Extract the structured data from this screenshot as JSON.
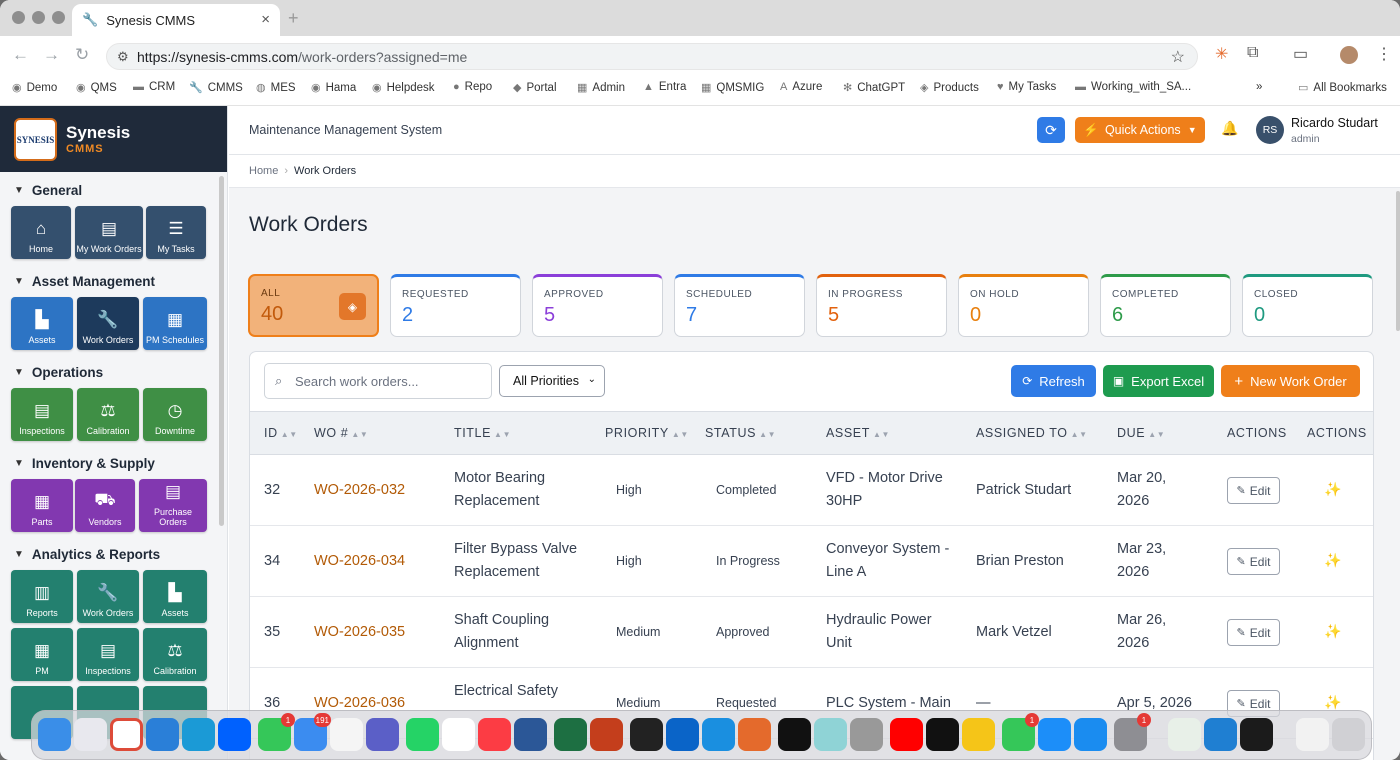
{
  "browser": {
    "tab_title": "Synesis CMMS",
    "url_host": "https://synesis-cmms.com",
    "url_path": "/work-orders?assigned=me",
    "bookmarks": [
      "Demo",
      "QMS",
      "CRM",
      "CMMS",
      "MES",
      "Hama",
      "Helpdesk",
      "Repo",
      "Portal",
      "Admin",
      "Entra",
      "QMSMIG",
      "Azure",
      "ChatGPT",
      "Products",
      "My Tasks",
      "Working_with_SA...",
      "All Bookmarks"
    ]
  },
  "brand": {
    "name": "Synesis",
    "sub": "CMMS",
    "logo_text": "SYNESIS"
  },
  "sidebar": {
    "sections": [
      {
        "title": "General",
        "items": [
          "Home",
          "My Work Orders",
          "My Tasks"
        ]
      },
      {
        "title": "Asset Management",
        "items": [
          "Assets",
          "Work Orders",
          "PM Schedules"
        ]
      },
      {
        "title": "Operations",
        "items": [
          "Inspections",
          "Calibration",
          "Downtime"
        ]
      },
      {
        "title": "Inventory & Supply",
        "items": [
          "Parts",
          "Vendors",
          "Purchase Orders"
        ]
      },
      {
        "title": "Analytics & Reports",
        "items": [
          "Reports",
          "Work Orders",
          "Assets",
          "PM",
          "Inspections",
          "Calibration"
        ]
      }
    ]
  },
  "header": {
    "system_title": "Maintenance Management System",
    "quick_actions": "Quick Actions",
    "user_initials": "RS",
    "user_name": "Ricardo Studart",
    "user_role": "admin"
  },
  "breadcrumb": {
    "home": "Home",
    "current": "Work Orders"
  },
  "page_title": "Work Orders",
  "status_cards": [
    {
      "label": "ALL",
      "value": "40",
      "color": "#ef7f1a"
    },
    {
      "label": "REQUESTED",
      "value": "2",
      "color": "#2f7be6"
    },
    {
      "label": "APPROVED",
      "value": "5",
      "color": "#8b3fd9"
    },
    {
      "label": "SCHEDULED",
      "value": "7",
      "color": "#2f7be6"
    },
    {
      "label": "IN PROGRESS",
      "value": "5",
      "color": "#e2620e"
    },
    {
      "label": "ON HOLD",
      "value": "0",
      "color": "#e8800f"
    },
    {
      "label": "COMPLETED",
      "value": "6",
      "color": "#2e9b4a"
    },
    {
      "label": "CLOSED",
      "value": "0",
      "color": "#1f9a80"
    }
  ],
  "filters": {
    "search_placeholder": "Search work orders...",
    "priority_selected": "All Priorities"
  },
  "actions": {
    "refresh": "Refresh",
    "export": "Export Excel",
    "new": "New Work Order"
  },
  "table": {
    "columns": [
      "ID",
      "WO #",
      "TITLE",
      "PRIORITY",
      "STATUS",
      "ASSET",
      "ASSIGNED TO",
      "DUE",
      "ACTIONS",
      "ACTIONS"
    ],
    "edit_label": "Edit",
    "rows": [
      {
        "id": "32",
        "wo": "WO-2026-032",
        "title1": "Motor Bearing",
        "title2": "Replacement",
        "priority": "High",
        "status": "Completed",
        "asset1": "VFD - Motor Drive",
        "asset2": "30HP",
        "assigned": "Patrick Studart",
        "due1": "Mar 20,",
        "due2": "2026"
      },
      {
        "id": "34",
        "wo": "WO-2026-034",
        "title1": "Filter Bypass Valve",
        "title2": "Replacement",
        "priority": "High",
        "status": "In Progress",
        "asset1": "Conveyor System -",
        "asset2": "Line A",
        "assigned": "Brian Preston",
        "due1": "Mar 23,",
        "due2": "2026"
      },
      {
        "id": "35",
        "wo": "WO-2026-035",
        "title1": "Shaft Coupling",
        "title2": "Alignment",
        "priority": "Medium",
        "status": "Approved",
        "asset1": "Hydraulic Power",
        "asset2": "Unit",
        "assigned": "Mark Vetzel",
        "due1": "Mar 26,",
        "due2": "2026"
      },
      {
        "id": "36",
        "wo": "WO-2026-036",
        "title1": "Electrical Safety",
        "title2": "",
        "priority": "Medium",
        "status": "Requested",
        "asset1": "PLC System - Main",
        "asset2": "",
        "assigned": "—",
        "due1": "Apr 5, 2026",
        "due2": ""
      }
    ]
  },
  "dock": {
    "badges": [
      "1",
      "191",
      "1",
      "1"
    ]
  }
}
